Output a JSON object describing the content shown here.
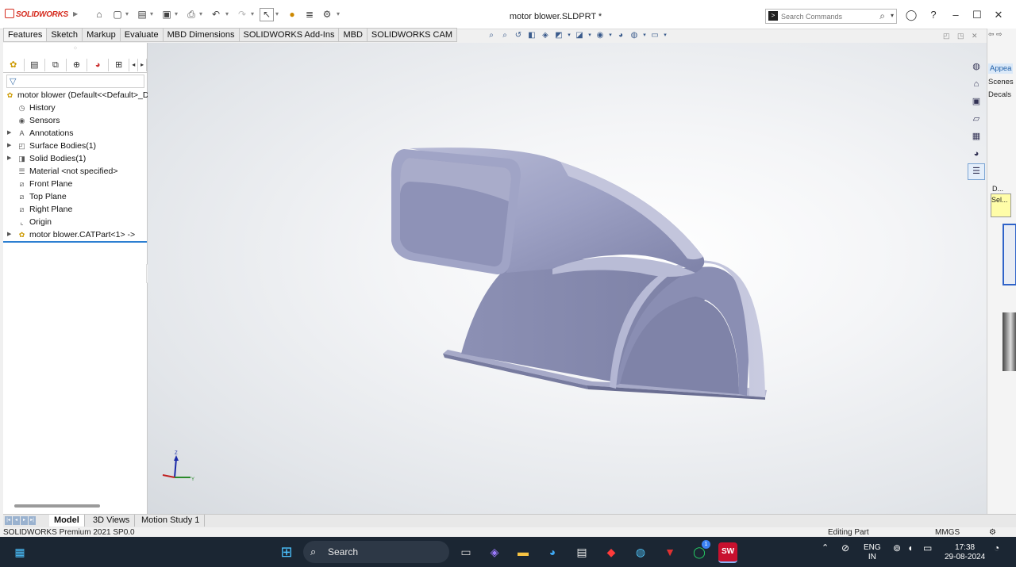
{
  "app": {
    "logo_text": "SOLIDWORKS",
    "window_title": "motor blower.SLDPRT *",
    "search_placeholder": "Search Commands"
  },
  "command_tabs": [
    "Features",
    "Sketch",
    "Markup",
    "Evaluate",
    "MBD Dimensions",
    "SOLIDWORKS Add-Ins",
    "MBD",
    "SOLIDWORKS CAM"
  ],
  "feature_tree": {
    "root": "motor blower  (Default<<Default>_D",
    "items": [
      {
        "label": "History",
        "icon": "history-icon",
        "expandable": false
      },
      {
        "label": "Sensors",
        "icon": "sensors-icon",
        "expandable": false
      },
      {
        "label": "Annotations",
        "icon": "annotations-icon",
        "expandable": true
      },
      {
        "label": "Surface Bodies(1)",
        "icon": "surface-bodies-icon",
        "expandable": true
      },
      {
        "label": "Solid Bodies(1)",
        "icon": "solid-bodies-icon",
        "expandable": true
      },
      {
        "label": "Material <not specified>",
        "icon": "material-icon",
        "expandable": false
      },
      {
        "label": "Front Plane",
        "icon": "plane-icon",
        "expandable": false
      },
      {
        "label": "Top Plane",
        "icon": "plane-icon",
        "expandable": false
      },
      {
        "label": "Right Plane",
        "icon": "plane-icon",
        "expandable": false
      },
      {
        "label": "Origin",
        "icon": "origin-icon",
        "expandable": false
      },
      {
        "label": "motor blower.CATPart<1> ->",
        "icon": "part-icon",
        "expandable": true
      }
    ]
  },
  "task_pane": {
    "items": [
      "Appea",
      "Scenes",
      "Decals"
    ],
    "d_label": "D...",
    "sel_label": "Sel..."
  },
  "triad": {
    "z": "Z",
    "y": "Y"
  },
  "bottom_tabs": [
    "Model",
    "3D Views",
    "Motion Study 1"
  ],
  "status": {
    "product": "SOLIDWORKS Premium 2021 SP0.0",
    "mode": "Editing Part",
    "units": "MMGS"
  },
  "taskbar": {
    "search_label": "Search",
    "lang_line1": "ENG",
    "lang_line2": "IN",
    "time": "17:38",
    "date": "29-08-2024",
    "whatsapp_badge": "1"
  },
  "colors": {
    "model_body": "#9b9fc2",
    "model_shadow": "#6f7396",
    "accent_blue": "#2c7fd1",
    "brand_red": "#d52b1e"
  }
}
